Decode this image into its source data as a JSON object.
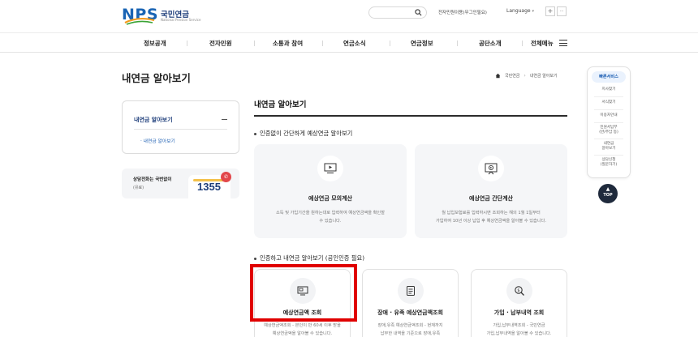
{
  "header": {
    "logo_text": "NPS",
    "logo_kr": "국민연금",
    "logo_en": "National Pension Service",
    "search_icon": "search-icon",
    "util_link": "전자민원이용(무그인필요)",
    "language": "Language",
    "plus": "+",
    "more": "···"
  },
  "nav": {
    "items": [
      "정보공개",
      "전자민원",
      "소통과 참여",
      "연금소식",
      "연금정보",
      "공단소개",
      "전체메뉴"
    ]
  },
  "page": {
    "title": "내연금 알아보기",
    "breadcrumb": [
      "국민연금",
      "내연금 알아보기"
    ]
  },
  "sidebar": {
    "head": "내연금 알아보기",
    "sub_item": "· 내연금 알아보기",
    "call_title": "상담전화는 국번없이",
    "call_sub": "(유료)",
    "call_number": "1355"
  },
  "main": {
    "title": "내연금 알아보기",
    "section1": "인증없이 간단하게 예상연금 알아보기",
    "section2": "인증하고 내연금 알아보기 (공인인증 필요)",
    "cards_top": [
      {
        "title": "예상연금 모의계산",
        "desc": [
          "소득 및 가입기간을 원하는대로 입력하여 예상연금액을 확인할",
          "수 있습니다."
        ]
      },
      {
        "title": "예상연금 간단계산",
        "desc": [
          "월 납입보험료를 입력하시면 조회하는 해의 1월 1일부터",
          "가입하여 10년 이상 납입 후 예상연금액을 알아볼 수 있습니다."
        ]
      }
    ],
    "cards_bottom": [
      {
        "title": "예상연금액 조회",
        "desc": [
          "예상연금액조회 - 본인이 만 60세 이후 받을",
          "예상연금액을 알아볼 수 있습니다."
        ]
      },
      {
        "title": "장애 · 유족 예상연금액조회",
        "desc": [
          "장애,유족 예상연금액조회 - 현재까지",
          "납부한 내역을 기준으로 장애,유족"
        ]
      },
      {
        "title": "가입 · 납부내역 조회",
        "desc": [
          "가입,납부내역조회 - 국민연금",
          "가입,납부내역을 알아볼 수 있습니다."
        ]
      }
    ]
  },
  "quick": {
    "head": "빠른서비스",
    "items": [
      [
        "지사찾기"
      ],
      [
        "서식찾기"
      ],
      [
        "이용자안내"
      ],
      [
        "민원서납부",
        "(반/주납 등)"
      ],
      [
        "내연금",
        "알아보기"
      ],
      [
        "상담신청",
        "(질문하기)"
      ]
    ],
    "top_label": "TOP"
  },
  "colors": {
    "brand_blue": "#1d3d7a",
    "link_blue": "#1d5fb3",
    "highlight_red": "#e00000",
    "badge_red": "#e2474b"
  }
}
